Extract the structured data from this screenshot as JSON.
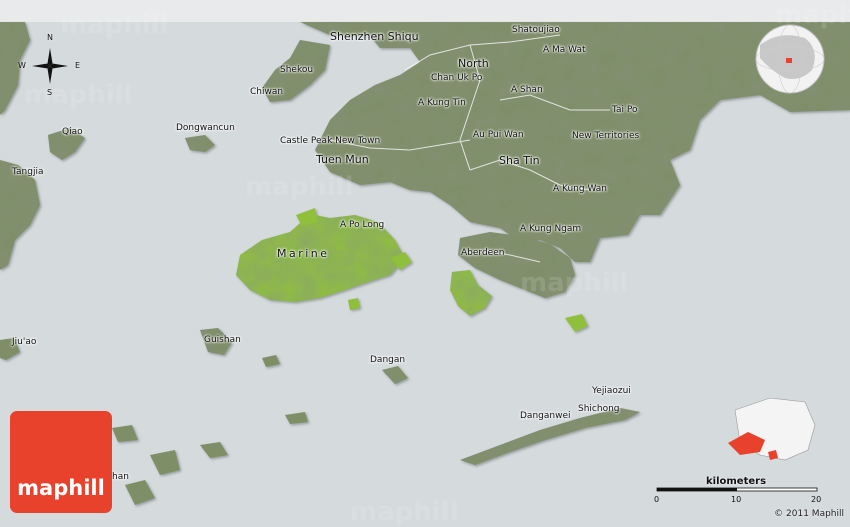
{
  "branding": {
    "logo_text": "maphill",
    "watermark_text": "maphill",
    "copyright": "© 2011 Maphill",
    "accent_color": "#e8412c"
  },
  "compass": {
    "north": "N",
    "south": "S",
    "east": "E",
    "west": "W",
    "icon": "compass-rose-icon"
  },
  "scale": {
    "title": "kilometers",
    "ticks": [
      "0",
      "10",
      "20"
    ]
  },
  "colors": {
    "water": "#d5dadd",
    "land": "#7e8f68",
    "highlight_land": "#8fbf3a",
    "roads": "#f2f2f2"
  },
  "labels": {
    "shenzhen_shiqu": "Shenzhen Shiqu",
    "shatoujiao": "Shatoujiao",
    "a_ma_wat": "A Ma Wat",
    "north": "North",
    "chan_uk_po": "Chan Uk Po",
    "shekou": "Shekou",
    "chiwan": "Chiwan",
    "a_shan": "A Shan",
    "a_kung_tin": "A Kung Tin",
    "tai_po": "Tai Po",
    "qiao": "Qiao",
    "dongwancun": "Dongwancun",
    "au_pui_wan": "Au Pui Wan",
    "new_territories": "New Territories",
    "castle_peak": "Castle Peak New Town",
    "tuen_mun": "Tuen Mun",
    "sha_tin": "Sha Tin",
    "tangjia": "Tangjia",
    "a_kung_wan": "A Kung Wan",
    "a_po_long": "A Po Long",
    "a_kung_ngam": "A Kung Ngam",
    "marine": "Marine",
    "aberdeen": "Aberdeen",
    "jiuao": "Jiu'ao",
    "guishan": "Guishan",
    "dangan": "Dangan",
    "yejiaozui": "Yejiaozui",
    "shichong": "Shichong",
    "danganwei": "Danganwei",
    "partial_han": "han"
  }
}
